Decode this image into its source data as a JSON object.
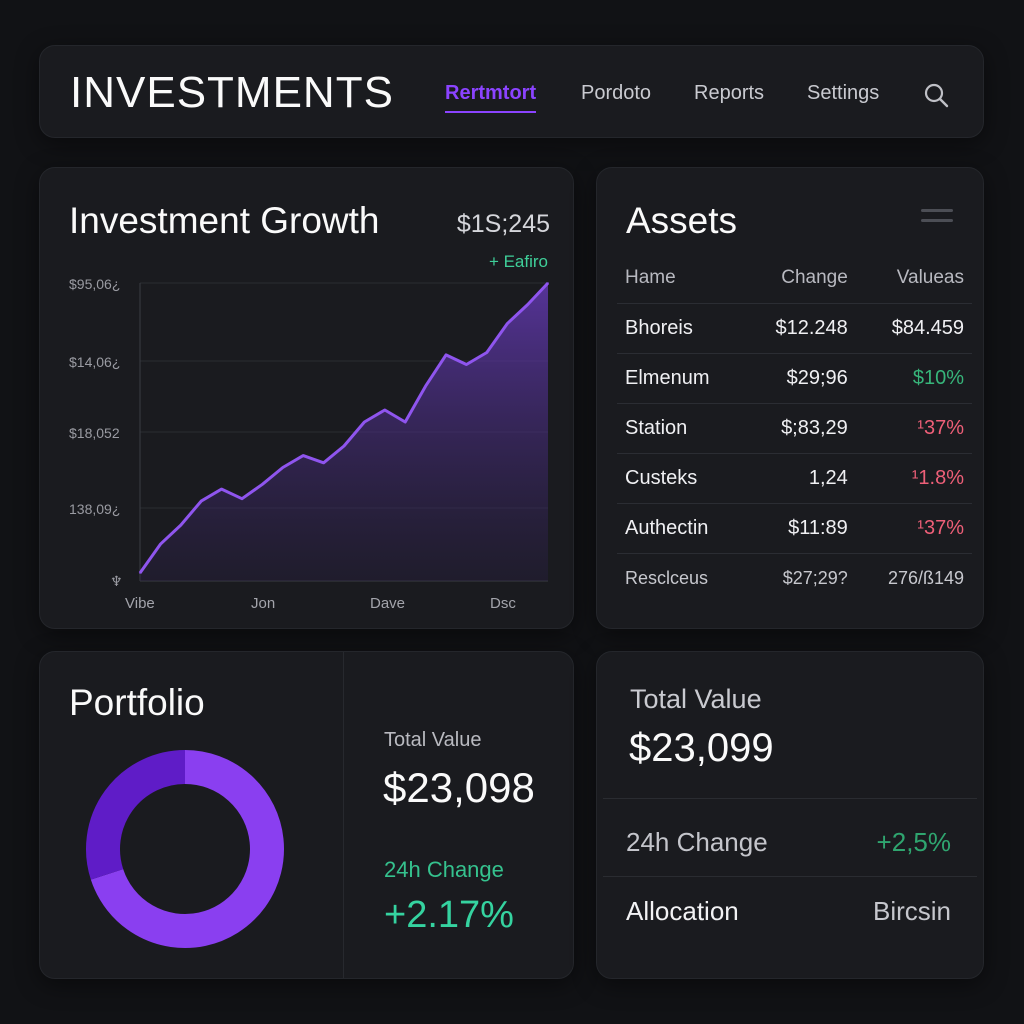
{
  "nav": {
    "brand": "INVESTMENTS",
    "tabs": [
      {
        "label": "Rertmtort",
        "active": true
      },
      {
        "label": "Pordoto",
        "active": false
      },
      {
        "label": "Reports",
        "active": false
      },
      {
        "label": "Settings",
        "active": false
      }
    ],
    "search_icon": "search-icon"
  },
  "growth": {
    "title": "Investment Growth",
    "value": "$1S;245",
    "delta": "+ Eafiro"
  },
  "assets": {
    "title": "Assets",
    "menu_icon": "menu-icon",
    "columns": [
      "Hame",
      "Change",
      "Valueas"
    ],
    "rows": [
      {
        "name": "Bhoreis",
        "change": "$12.248",
        "value": "$84.459",
        "value_status": "neutral"
      },
      {
        "name": "Elmenum",
        "change": "$29;96",
        "value": "$10%",
        "value_status": "positive"
      },
      {
        "name": "Station",
        "change": "$;83,29",
        "value": "¹37%",
        "value_status": "negative"
      },
      {
        "name": "Custeks",
        "change": "1,24",
        "value": "¹1.8%",
        "value_status": "negative"
      },
      {
        "name": "Authectin",
        "change": "$11:89",
        "value": "¹37%",
        "value_status": "negative"
      },
      {
        "name": "Resclceus",
        "change": "$27;29?",
        "value": "276/ß149",
        "value_status": "neutral"
      }
    ]
  },
  "portfolio": {
    "title": "Portfolio",
    "total_label": "Total Value",
    "total_value": "$23,098",
    "change_label": "24h Change",
    "change_value": "+2.17%",
    "allocation": [
      {
        "share": 0.7,
        "color": "#8a3ff0"
      },
      {
        "share": 0.3,
        "color": "#5f1cc7"
      }
    ]
  },
  "total": {
    "label": "Total Value",
    "value": "$23,099",
    "change_label": "24h Change",
    "change_value": "+2,5%",
    "allocation_label": "Allocation",
    "allocation_value": "Bircsin"
  },
  "colors": {
    "accent": "#8b43ff",
    "positive": "#37b57a",
    "negative": "#ee5f78",
    "card": "#1a1b1f",
    "background": "#111215"
  },
  "chart_data": {
    "type": "area",
    "ylabels": [
      "$95,06¿",
      "$14,06¿",
      "$18,052",
      "138,09¿"
    ],
    "xlabels": [
      "Vibe",
      "Jon",
      "Dave",
      "Dsc"
    ],
    "series": [
      {
        "values": [
          0,
          12,
          20,
          30,
          35,
          31,
          37,
          44,
          49,
          46,
          53,
          63,
          68,
          63,
          78,
          91,
          87,
          92,
          104,
          112,
          121
        ]
      }
    ],
    "grid": true
  }
}
